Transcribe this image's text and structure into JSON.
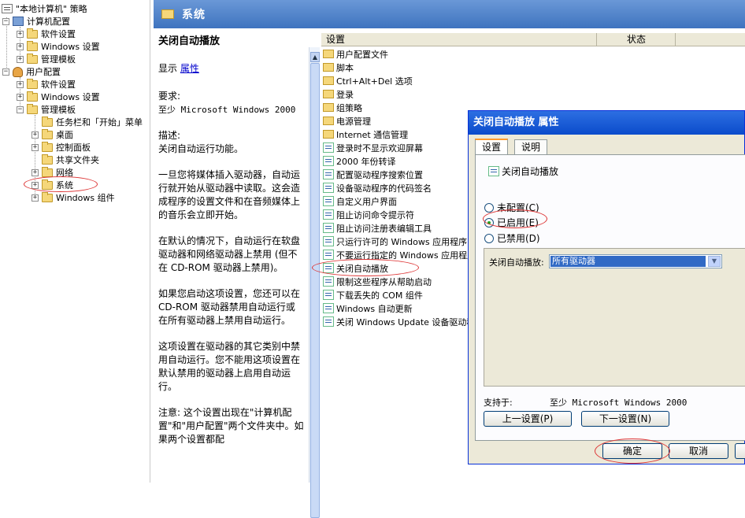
{
  "tree": {
    "root": "\"本地计算机\" 策略",
    "computer_config": "计算机配置",
    "cc_software": "软件设置",
    "cc_windows": "Windows 设置",
    "cc_admin": "管理模板",
    "user_config": "用户配置",
    "uc_software": "软件设置",
    "uc_windows": "Windows 设置",
    "uc_admin": "管理模板",
    "taskbar": "任务栏和「开始」菜单",
    "desktop": "桌面",
    "control_panel": "控制面板",
    "shared": "共享文件夹",
    "network": "网络",
    "system": "系统",
    "win_components": "Windows 组件"
  },
  "banner": {
    "title": "系统"
  },
  "description": {
    "title": "关闭自动播放",
    "display_label": "显示",
    "properties_link": "属性",
    "req_label": "要求:",
    "req_value": "至少 Microsoft Windows 2000",
    "desc_label": "描述:",
    "desc_p1": "关闭自动运行功能。",
    "desc_p2": "一旦您将媒体插入驱动器，自动运行就开始从驱动器中读取。这会造成程序的设置文件和在音频媒体上的音乐会立即开始。",
    "desc_p3": "在默认的情况下，自动运行在软盘驱动器和网络驱动器上禁用 (但不在 CD-ROM 驱动器上禁用)。",
    "desc_p4": "如果您启动这项设置，您还可以在 CD-ROM 驱动器禁用自动运行或在所有驱动器上禁用自动运行。",
    "desc_p5": "这项设置在驱动器的其它类别中禁用自动运行。您不能用这项设置在默认禁用的驱动器上启用自动运行。",
    "desc_p6": "注意: 这个设置出现在\"计算机配置\"和\"用户配置\"两个文件夹中。如果两个设置都配"
  },
  "list": {
    "col_setting": "设置",
    "col_state": "状态",
    "items": [
      "用户配置文件",
      "脚本",
      "Ctrl+Alt+Del 选项",
      "登录",
      "组策略",
      "电源管理",
      "Internet 通信管理",
      "登录时不显示欢迎屏幕",
      "2000 年份转译",
      "配置驱动程序搜索位置",
      "设备驱动程序的代码签名",
      "自定义用户界面",
      "阻止访问命令提示符",
      "阻止访问注册表编辑工具",
      "只运行许可的 Windows 应用程序",
      "不要运行指定的 Windows 应用程序",
      "关闭自动播放",
      "限制这些程序从帮助启动",
      "下载丢失的 COM 组件",
      "Windows 自动更新",
      "关闭 Windows Update 设备驱动程序"
    ]
  },
  "dialog": {
    "title": "关闭自动播放 属性",
    "tab_settings": "设置",
    "tab_explain": "说明",
    "policy_name": "关闭自动播放",
    "opt_not_configured": "未配置(C)",
    "opt_enabled": "已启用(E)",
    "opt_disabled": "已禁用(D)",
    "option_label": "关闭自动播放:",
    "option_value": "所有驱动器",
    "supported_label": "支持于:",
    "supported_value": "至少 Microsoft Windows 2000",
    "prev_button": "上一设置(P)",
    "next_button": "下一设置(N)",
    "ok_button": "确定",
    "cancel_button": "取消"
  }
}
